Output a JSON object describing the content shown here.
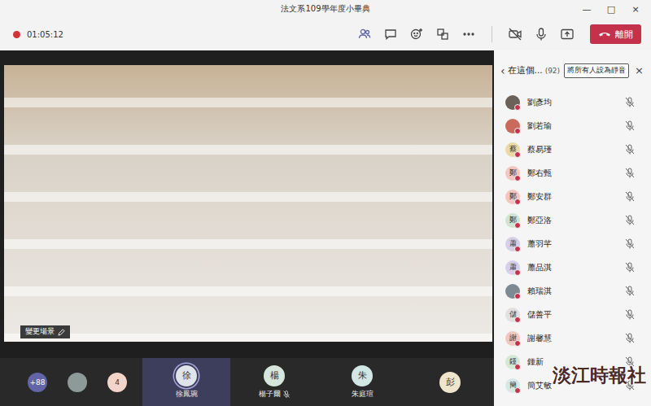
{
  "window": {
    "title": "法文系109學年度小畢典",
    "controls": [
      "—",
      "□",
      "×"
    ]
  },
  "toolbar": {
    "recording": true,
    "timer": "01:05:12",
    "tools": [
      {
        "kind": "participants",
        "selected": true
      },
      {
        "kind": "chat",
        "selected": false
      },
      {
        "kind": "reactions",
        "selected": false
      },
      {
        "kind": "rooms",
        "selected": false
      },
      {
        "kind": "more",
        "selected": false
      }
    ],
    "devices": [
      {
        "kind": "camera",
        "on": false
      },
      {
        "kind": "mic",
        "on": true
      },
      {
        "kind": "share",
        "on": false
      }
    ],
    "leave_button": "離開"
  },
  "stage": {
    "scene_button": "變更場景"
  },
  "strip": {
    "chips": [
      {
        "kind": "count",
        "label": "+88",
        "color": "#6264a7"
      },
      {
        "kind": "photo",
        "label": "",
        "color": "#8e9a98"
      },
      {
        "kind": "initial",
        "label": "4",
        "color": "#f2d5c8"
      }
    ],
    "tiles": [
      {
        "initial": "徐",
        "name": "徐鳳琬",
        "selected": true,
        "speaking": true,
        "muted": false,
        "color": "#dfe3ea"
      },
      {
        "initial": "楊",
        "name": "楊子爾",
        "selected": false,
        "speaking": false,
        "muted": true,
        "color": "#d7e6dc"
      },
      {
        "initial": "朱",
        "name": "朱庭瑄",
        "selected": false,
        "speaking": false,
        "muted": false,
        "color": "#d3e6e6"
      },
      {
        "initial": "彭",
        "selected": false,
        "speaking": false,
        "muted": false,
        "color": "#efe4cc"
      }
    ]
  },
  "panel": {
    "back": "‹",
    "title": "在這個...",
    "count": "(92)",
    "mute_all": "將所有人設為靜音",
    "close": "×"
  },
  "participants": [
    {
      "name": "劉彥均",
      "kind": "photo",
      "initial": "",
      "color": "#6b6158",
      "busy": true,
      "muted": true
    },
    {
      "name": "劉若瑜",
      "kind": "photo",
      "initial": "",
      "color": "#c96a5a",
      "busy": true,
      "muted": true
    },
    {
      "name": "蔡易瑾",
      "kind": "initial",
      "initial": "蔡",
      "color": "#ead9a4",
      "busy": true,
      "muted": true
    },
    {
      "name": "鄭右甄",
      "kind": "initial",
      "initial": "鄭",
      "color": "#f3c6c1",
      "busy": true,
      "muted": true
    },
    {
      "name": "鄭安群",
      "kind": "initial",
      "initial": "鄭",
      "color": "#f3c6c1",
      "busy": true,
      "muted": true
    },
    {
      "name": "鄭亞洛",
      "kind": "initial",
      "initial": "鄭",
      "color": "#cfe4d2",
      "busy": true,
      "muted": true
    },
    {
      "name": "蕭羽芊",
      "kind": "initial",
      "initial": "蕭",
      "color": "#d6cfea",
      "busy": true,
      "muted": true
    },
    {
      "name": "蕭品淇",
      "kind": "initial",
      "initial": "蕭",
      "color": "#d6cfea",
      "busy": true,
      "muted": true
    },
    {
      "name": "賴瑞淇",
      "kind": "photo",
      "initial": "",
      "color": "#7d8a94",
      "busy": true,
      "muted": true
    },
    {
      "name": "儲善平",
      "kind": "initial",
      "initial": "儲",
      "color": "#e1e1e1",
      "busy": true,
      "muted": true
    },
    {
      "name": "謝馨慧",
      "kind": "initial",
      "initial": "謝",
      "color": "#f3c6c1",
      "busy": true,
      "muted": true
    },
    {
      "name": "鍾新",
      "kind": "initial",
      "initial": "鍾",
      "color": "#d4e8d6",
      "busy": true,
      "muted": true
    },
    {
      "name": "簡艾敏",
      "kind": "initial",
      "initial": "簡",
      "color": "#d6e7e7",
      "busy": true,
      "muted": true
    }
  ],
  "watermark": "淡江時報社"
}
